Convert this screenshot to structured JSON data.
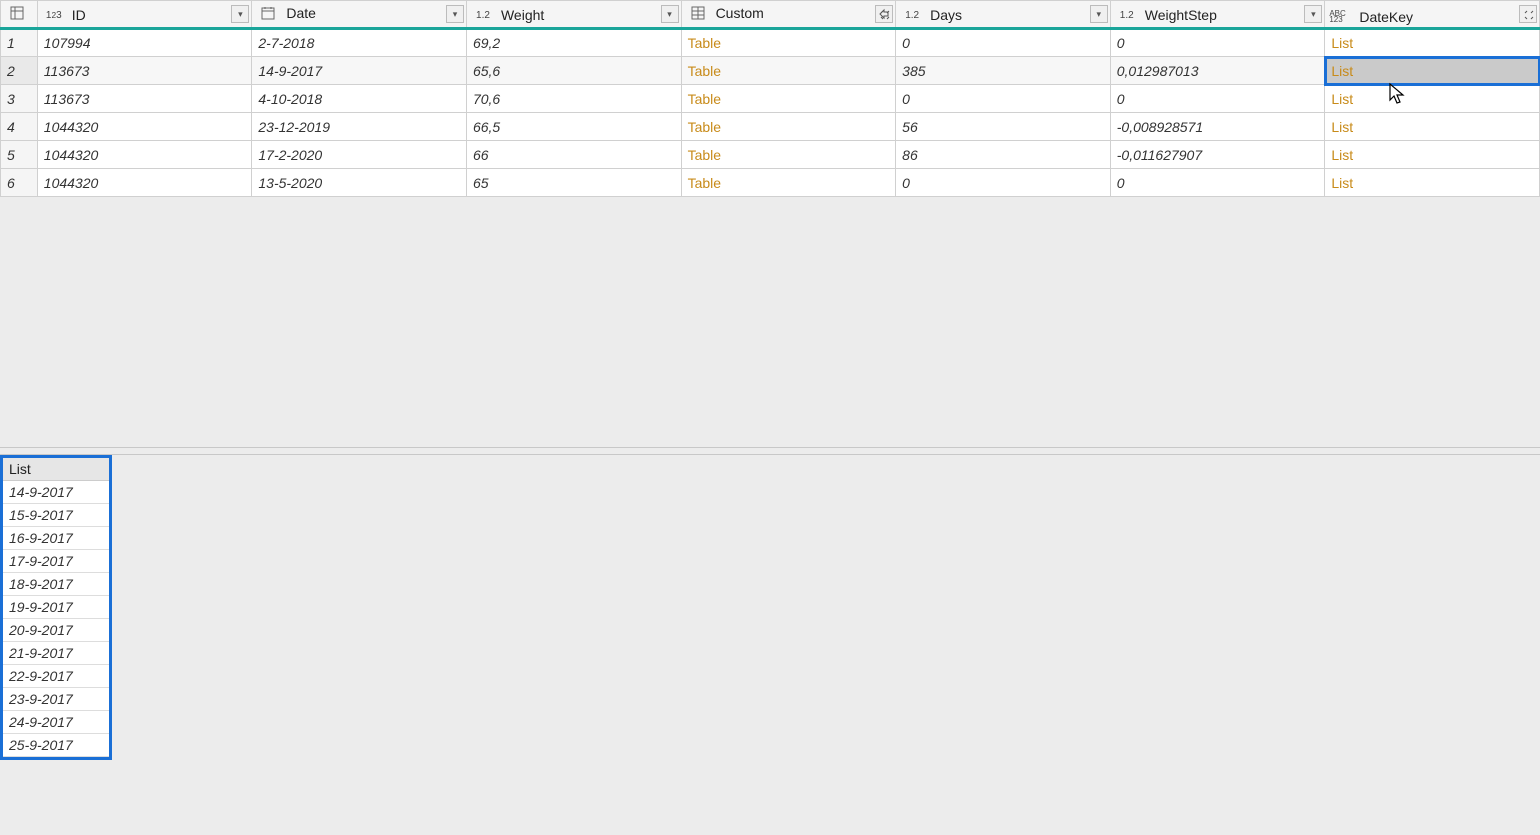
{
  "columns": {
    "id": {
      "label": "ID",
      "type": "1²3"
    },
    "date": {
      "label": "Date",
      "type": "cal"
    },
    "weight": {
      "label": "Weight",
      "type": "1.2"
    },
    "custom": {
      "label": "Custom",
      "type": "tbl"
    },
    "days": {
      "label": "Days",
      "type": "1.2"
    },
    "step": {
      "label": "WeightStep",
      "type": "1.2"
    },
    "dkey": {
      "label": "DateKey",
      "type": "ABC123"
    }
  },
  "rows": [
    {
      "n": 1,
      "id": "107994",
      "date": "2-7-2018",
      "weight": "69,2",
      "custom": "Table",
      "days": "0",
      "step": "0",
      "dkey": "List"
    },
    {
      "n": 2,
      "id": "113673",
      "date": "14-9-2017",
      "weight": "65,6",
      "custom": "Table",
      "days": "385",
      "step": "0,012987013",
      "dkey": "List",
      "selected": true
    },
    {
      "n": 3,
      "id": "113673",
      "date": "4-10-2018",
      "weight": "70,6",
      "custom": "Table",
      "days": "0",
      "step": "0",
      "dkey": "List"
    },
    {
      "n": 4,
      "id": "1044320",
      "date": "23-12-2019",
      "weight": "66,5",
      "custom": "Table",
      "days": "56",
      "step": "-0,008928571",
      "dkey": "List"
    },
    {
      "n": 5,
      "id": "1044320",
      "date": "17-2-2020",
      "weight": "66",
      "custom": "Table",
      "days": "86",
      "step": "-0,011627907",
      "dkey": "List"
    },
    {
      "n": 6,
      "id": "1044320",
      "date": "13-5-2020",
      "weight": "65",
      "custom": "Table",
      "days": "0",
      "step": "0",
      "dkey": "List"
    }
  ],
  "preview": {
    "header": "List",
    "items": [
      "14-9-2017",
      "15-9-2017",
      "16-9-2017",
      "17-9-2017",
      "18-9-2017",
      "19-9-2017",
      "20-9-2017",
      "21-9-2017",
      "22-9-2017",
      "23-9-2017",
      "24-9-2017",
      "25-9-2017"
    ]
  }
}
